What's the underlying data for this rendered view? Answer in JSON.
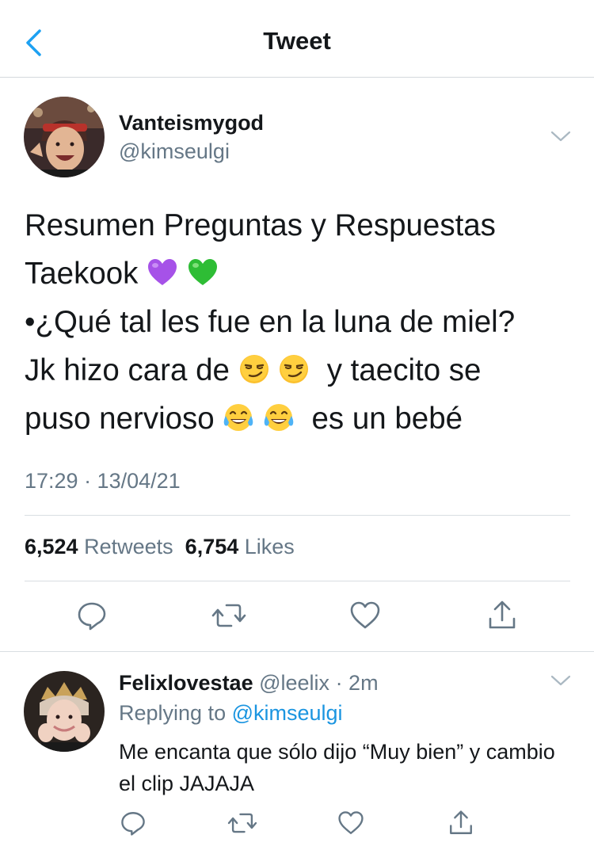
{
  "header": {
    "title": "Tweet"
  },
  "tweet": {
    "display_name": "Vanteismygod",
    "handle": "@kimseulgi",
    "lines": [
      {
        "parts": [
          {
            "t": "Resumen Preguntas y Respuestas"
          }
        ]
      },
      {
        "parts": [
          {
            "t": "Taekook "
          },
          {
            "e": "purple-heart-emoji"
          },
          {
            "t": " "
          },
          {
            "e": "green-heart-emoji"
          }
        ]
      },
      {
        "parts": [
          {
            "t": "•¿Qué tal les fue en la luna de miel?"
          }
        ]
      },
      {
        "parts": [
          {
            "t": "Jk hizo cara de "
          },
          {
            "e": "smirk-emoji"
          },
          {
            "t": " "
          },
          {
            "e": "smirk-emoji"
          },
          {
            "t": "  y taecito se"
          }
        ]
      },
      {
        "parts": [
          {
            "t": "puso nervioso "
          },
          {
            "e": "tears-of-joy-emoji"
          },
          {
            "t": " "
          },
          {
            "e": "tears-of-joy-emoji"
          },
          {
            "t": "  es un bebé"
          }
        ]
      }
    ],
    "timestamp": "17:29 · 13/04/21",
    "retweets_count": "6,524",
    "retweets_label": "Retweets",
    "likes_count": "6,754",
    "likes_label": "Likes"
  },
  "reply": {
    "display_name": "Felixlovestae",
    "handle": "@leelix",
    "time": "· 2m",
    "replying_prefix": "Replying to",
    "replying_to": "@kimseulgi",
    "text": "Me encanta que sólo dijo “Muy bien” y cambio el clip JAJAJA"
  },
  "colors": {
    "accent": "#1da1f2",
    "muted": "#657786",
    "text": "#14171a",
    "divider": "#d9dee2"
  }
}
